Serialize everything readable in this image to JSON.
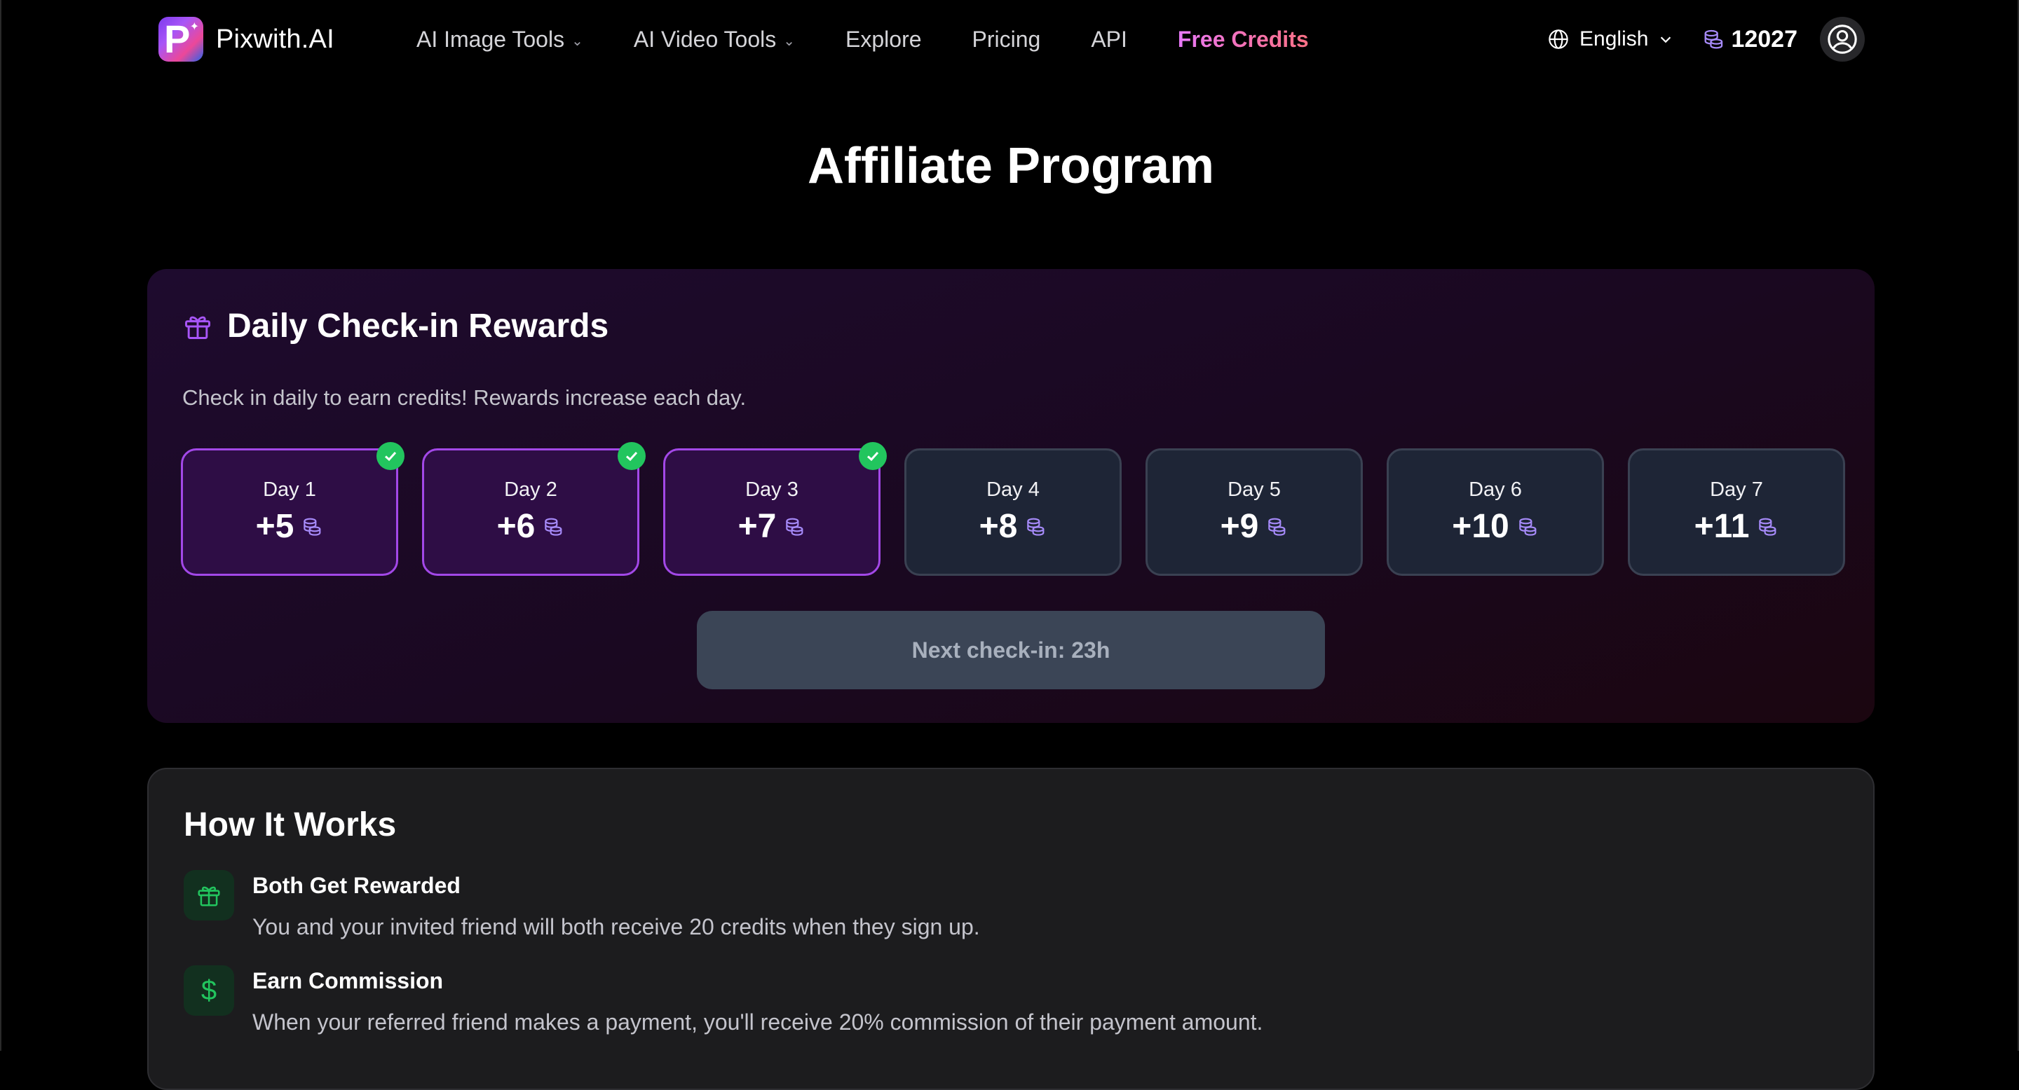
{
  "nav": {
    "brand": "Pixwith.AI",
    "logo_letter": "P",
    "items": [
      {
        "label": "AI Image Tools",
        "dropdown": true
      },
      {
        "label": "AI Video Tools",
        "dropdown": true
      },
      {
        "label": "Explore",
        "dropdown": false
      },
      {
        "label": "Pricing",
        "dropdown": false
      },
      {
        "label": "API",
        "dropdown": false
      },
      {
        "label": "Free Credits",
        "dropdown": false
      }
    ],
    "language": "English",
    "credits": "12027"
  },
  "page": {
    "title": "Affiliate Program"
  },
  "checkin": {
    "title": "Daily Check-in Rewards",
    "description": "Check in daily to earn credits! Rewards increase each day.",
    "days": [
      {
        "label": "Day 1",
        "reward": "+5",
        "checked": true
      },
      {
        "label": "Day 2",
        "reward": "+6",
        "checked": true
      },
      {
        "label": "Day 3",
        "reward": "+7",
        "checked": true
      },
      {
        "label": "Day 4",
        "reward": "+8",
        "checked": false
      },
      {
        "label": "Day 5",
        "reward": "+9",
        "checked": false
      },
      {
        "label": "Day 6",
        "reward": "+10",
        "checked": false
      },
      {
        "label": "Day 7",
        "reward": "+11",
        "checked": false
      }
    ],
    "next_button": "Next check-in: 23h"
  },
  "how": {
    "title": "How It Works",
    "items": [
      {
        "title": "Both Get Rewarded",
        "description": "You and your invited friend will both receive 20 credits when they sign up.",
        "icon": "gift-icon"
      },
      {
        "title": "Earn Commission",
        "description": "When your referred friend makes a payment, you'll receive 20% commission of their payment amount.",
        "icon": "dollar-icon"
      }
    ]
  },
  "colors": {
    "accent_purple": "#a348e8",
    "check_green": "#22c55e",
    "free_credits_gradient": [
      "#e879f9",
      "#fb7185"
    ]
  }
}
